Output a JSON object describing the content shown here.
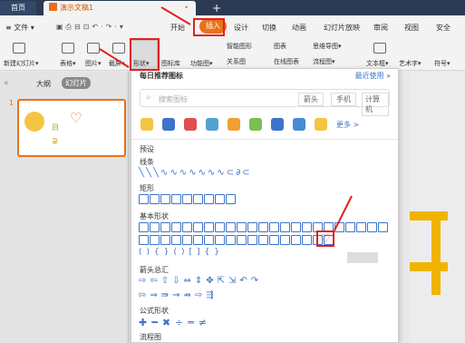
{
  "titlebar": {
    "home": "首页",
    "doc_tab": "演示文稿1",
    "dot": "•",
    "plus": "+"
  },
  "menubar": {
    "file": "≡ 文件 ▾",
    "start": "开始",
    "insert": "插入",
    "design": "设计",
    "switch": "切换",
    "anim": "动画",
    "slideshow": "幻灯片放映",
    "review": "审阅",
    "view": "视图",
    "security": "安全"
  },
  "ribbon": {
    "new_slide": "新建幻灯片▾",
    "table": "表格▾",
    "image": "图片▾",
    "screenshot": "截屏▾",
    "shape": "形状▾",
    "iconlib": "图标库",
    "funcmap": "功能图▾",
    "smartart": "智能图形",
    "chart": "图表",
    "mindmap": "思维导图▾",
    "relation": "关系图",
    "online_chart": "在线图表",
    "flowchart": "流程图▾",
    "textbox": "文本框▾",
    "wordart": "艺术字▾",
    "symbol": "符号▾"
  },
  "left_panel": {
    "outline": "大纲",
    "slides": "幻灯片",
    "slide_number": "1",
    "collapse": "«",
    "thumb_text1": "目",
    "thumb_text2": "录"
  },
  "popup": {
    "recent_title": "每日推荐图标",
    "recent_link": "最近使用 »",
    "search_placeholder": "搜索图标",
    "tag1": "箭头",
    "tag2": "手机",
    "tag3": "计算机",
    "more": "更多 >",
    "preset": "预设",
    "lines": "线条",
    "rect": "矩形",
    "basic": "基本形状",
    "arrows": "箭头总汇",
    "formula": "公式形状",
    "flow": "流程图"
  },
  "colors": {
    "accent": "#e8731b",
    "shape_blue": "#3d74c9",
    "highlight": "#e02020",
    "title_bg": "#2b3a52"
  }
}
